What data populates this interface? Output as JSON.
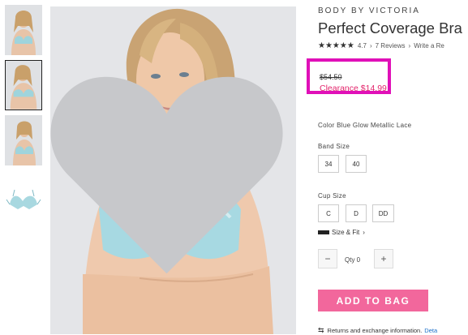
{
  "thumbnails": [
    {
      "name": "thumb-1",
      "selected": false
    },
    {
      "name": "thumb-2",
      "selected": true
    },
    {
      "name": "thumb-3",
      "selected": false
    },
    {
      "name": "thumb-4",
      "selected": false
    }
  ],
  "product": {
    "brand": "BODY BY VICTORIA",
    "title": "Perfect Coverage Bra",
    "stars": "★★★★★",
    "rating": "4.7",
    "reviews": "7 Reviews",
    "write_review": "Write a Re",
    "was_price": "$54.50",
    "sale_price": "Clearance $14.99",
    "color": "Color Blue Glow Metallic Lace"
  },
  "band": {
    "label": "Band Size",
    "options": [
      "34",
      "40"
    ]
  },
  "cup": {
    "label": "Cup Size",
    "options": [
      "C",
      "D",
      "DD"
    ]
  },
  "size_fit": "Size & Fit",
  "quantity": {
    "minus": "−",
    "label": "Qty 0",
    "plus": "+"
  },
  "add_to_bag": "ADD TO BAG",
  "returns": {
    "text": "Returns and exchange information.",
    "link": "Deta"
  },
  "colors": {
    "highlight": "#e010b8",
    "sale": "#e3246b",
    "button": "#f2679c"
  }
}
